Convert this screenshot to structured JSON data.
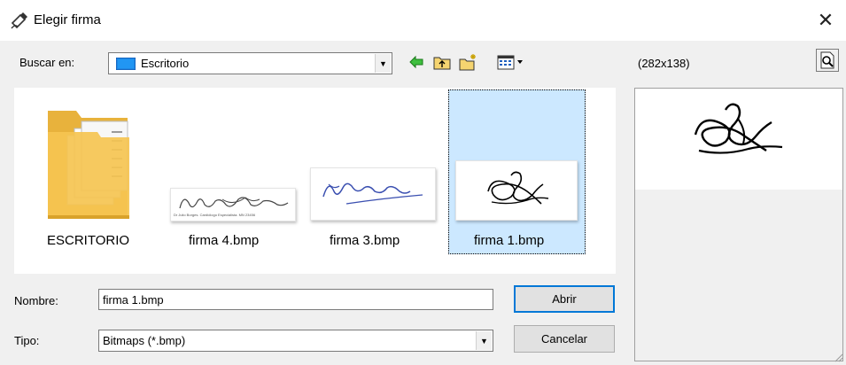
{
  "window": {
    "title": "Elegir firma"
  },
  "lookin": {
    "label": "Buscar en:",
    "value": "Escritorio"
  },
  "toolbar": {
    "icons": [
      "back-arrow-icon",
      "up-folder-icon",
      "new-folder-icon",
      "view-menu-icon"
    ]
  },
  "files": [
    {
      "name": "ESCRITORIO",
      "type": "folder"
    },
    {
      "name": "firma 4.bmp",
      "type": "bmp"
    },
    {
      "name": "firma 3.bmp",
      "type": "bmp"
    },
    {
      "name": "firma 1.bmp",
      "type": "bmp",
      "selected": true
    }
  ],
  "thumb4_caption": "Dr Julio Borges. Cardiólogo Especialista. MN 23456",
  "name_field": {
    "label": "Nombre:",
    "value": "firma 1.bmp"
  },
  "type_field": {
    "label": "Tipo:",
    "value": "Bitmaps (*.bmp)"
  },
  "buttons": {
    "open": "Abrir",
    "cancel": "Cancelar"
  },
  "preview": {
    "size_text": "(282x138)"
  },
  "colors": {
    "selection": "#cce8ff",
    "default_button_border": "#0078d7",
    "folder": "#f5c451",
    "signature_blue": "#3a4fb0"
  }
}
